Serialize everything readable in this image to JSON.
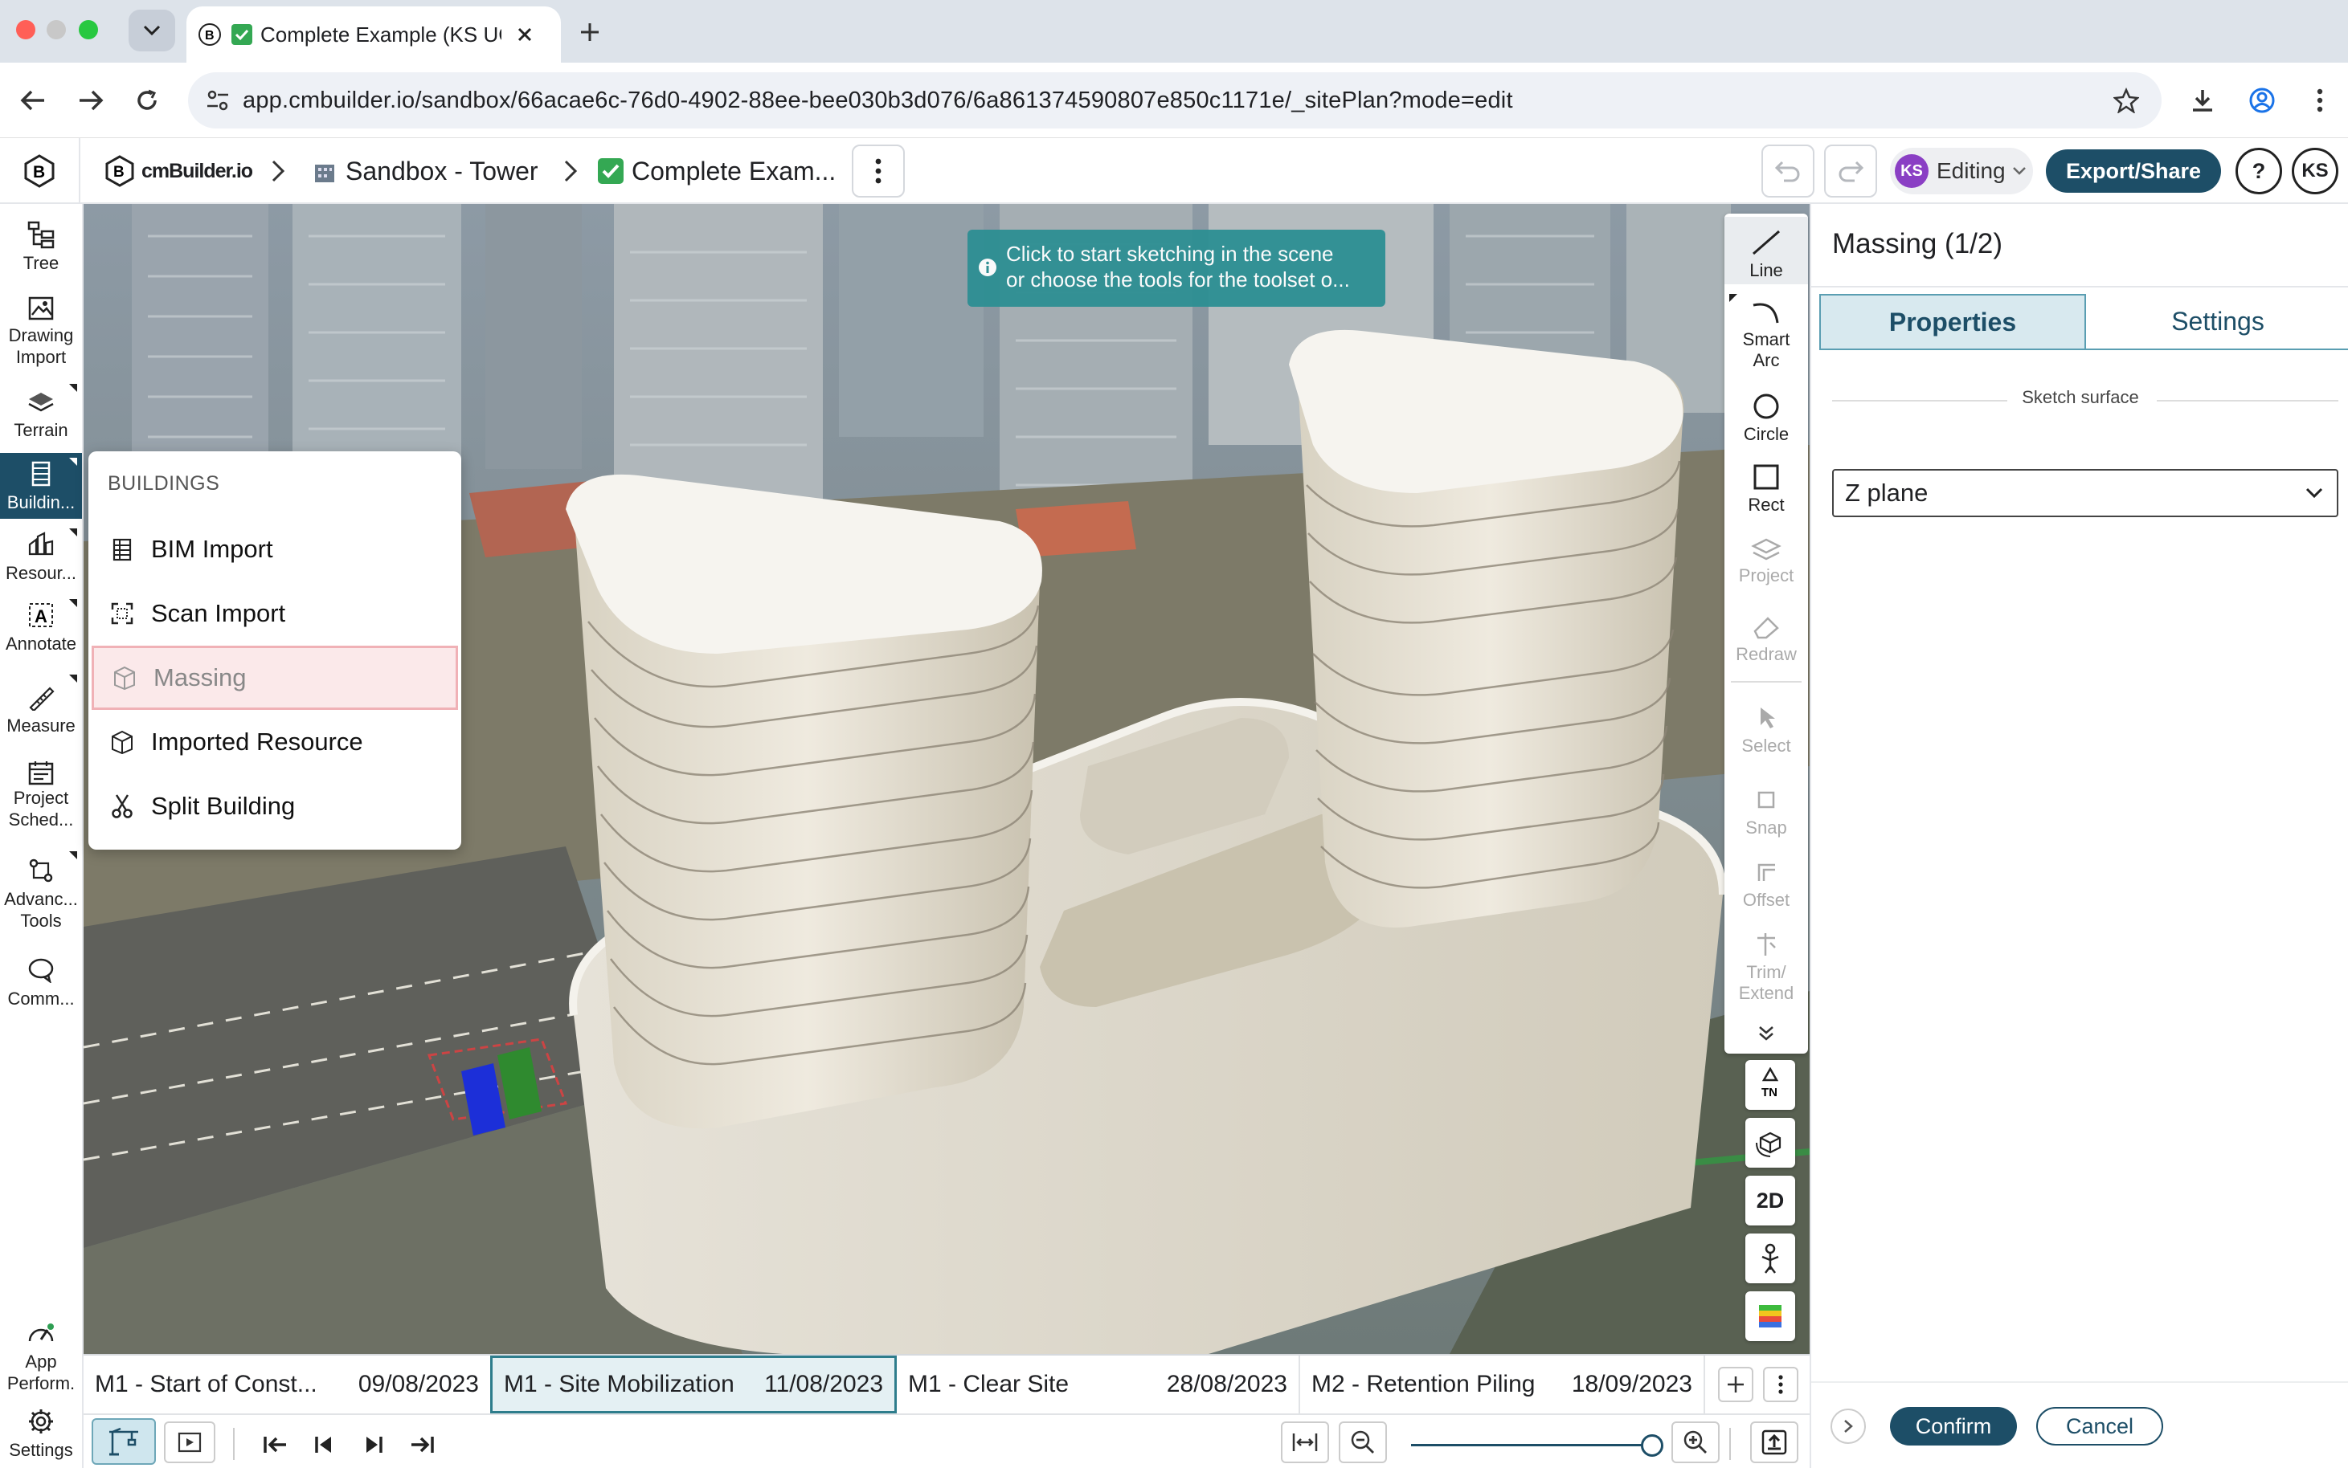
{
  "browser": {
    "tab_title": "Complete Example (KS UG",
    "url": "app.cmbuilder.io/sandbox/66acae6c-76d0-4902-88ee-bee030b3d076/6a861374590807e850c1171e/_sitePlan?mode=edit"
  },
  "header": {
    "logo_text": "cmBuilder.io",
    "breadcrumbs": [
      "Sandbox - Tower",
      "Complete Exam..."
    ],
    "editing_avatar": "KS",
    "editing_label": "Editing",
    "export_label": "Export/Share",
    "help_label": "?",
    "user_avatar": "KS"
  },
  "sidebar": {
    "items": [
      {
        "label": "Tree",
        "icon": "tree-icon"
      },
      {
        "label": "Drawing\nImport",
        "icon": "drawing-import-icon"
      },
      {
        "label": "Terrain",
        "icon": "terrain-icon"
      },
      {
        "label": "Buildin...",
        "icon": "building-icon"
      },
      {
        "label": "Resour...",
        "icon": "resources-icon"
      },
      {
        "label": "Annotate",
        "icon": "annotate-icon"
      },
      {
        "label": "Measure",
        "icon": "measure-icon"
      },
      {
        "label": "Project\nSched...",
        "icon": "calendar-icon"
      },
      {
        "label": "Advanc...\nTools",
        "icon": "advanced-tools-icon"
      },
      {
        "label": "Comm...",
        "icon": "comment-icon"
      },
      {
        "label": "App\nPerform.",
        "icon": "gauge-icon"
      },
      {
        "label": "Settings",
        "icon": "gear-icon"
      }
    ]
  },
  "scene": {
    "tooltip_line1": "Click to start sketching in the scene",
    "tooltip_line2": "or choose the tools for the toolset o..."
  },
  "buildings_menu": {
    "header": "BUILDINGS",
    "items": [
      "BIM Import",
      "Scan Import",
      "Massing",
      "Imported Resource",
      "Split Building"
    ],
    "selected": "Massing"
  },
  "sketch_tools": {
    "items": [
      "Line",
      "Smart\nArc",
      "Circle",
      "Rect",
      "Project",
      "Redraw",
      "Select",
      "Snap",
      "Offset",
      "Trim/\nExtend"
    ]
  },
  "view_controls": {
    "north": "TN",
    "two_d": "2D"
  },
  "timeline": {
    "milestones": [
      {
        "name": "M1 - Start of Const...",
        "date": "09/08/2023"
      },
      {
        "name": "M1 - Site Mobilization",
        "date": "11/08/2023"
      },
      {
        "name": "M1 - Clear Site",
        "date": "28/08/2023"
      },
      {
        "name": "M2 - Retention Piling",
        "date": "18/09/2023"
      }
    ],
    "selected_index": 1,
    "zoom_level": 1.0
  },
  "panel": {
    "title": "Massing (1/2)",
    "tabs": [
      "Properties",
      "Settings"
    ],
    "active_tab": "Properties",
    "sketch_surface_label": "Sketch surface",
    "sketch_surface_value": "Z plane",
    "confirm_label": "Confirm",
    "cancel_label": "Cancel"
  },
  "colors": {
    "primary": "#1d4e67",
    "tooltip": "#2d8f93",
    "selected_menu_bg": "#fbe9ea",
    "tab_active_bg": "#d8e9ef"
  }
}
